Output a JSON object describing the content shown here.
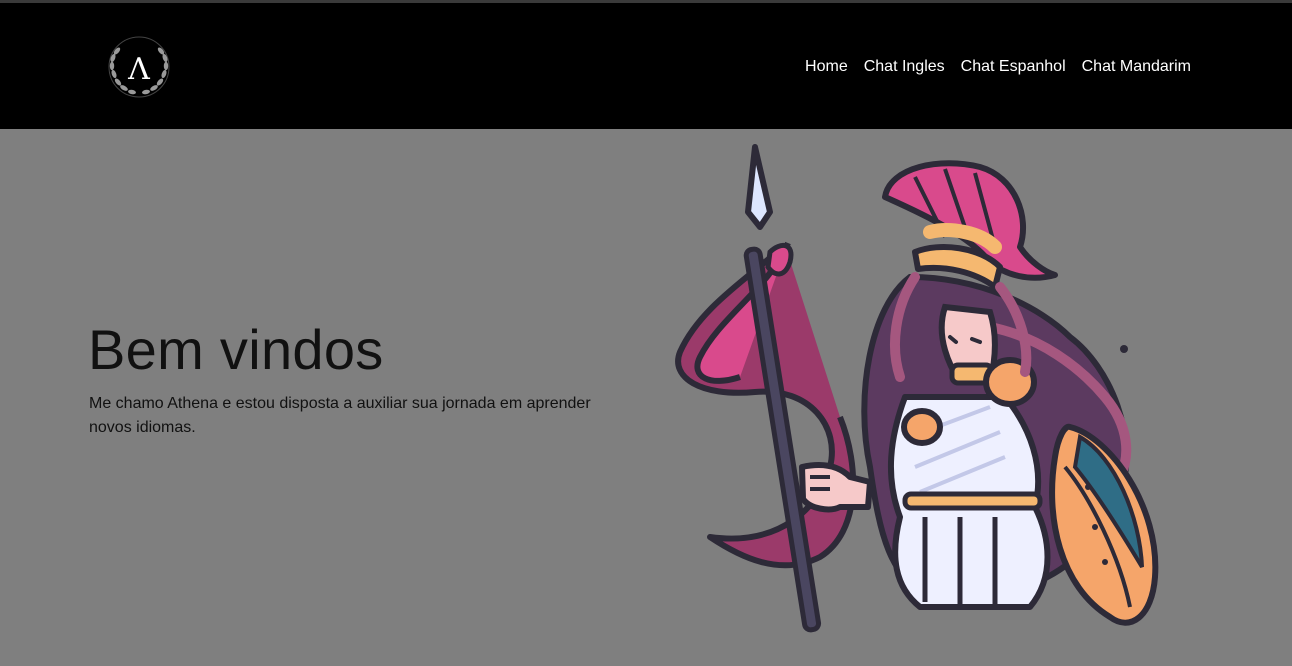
{
  "nav": {
    "items": [
      {
        "label": "Home"
      },
      {
        "label": "Chat Ingles"
      },
      {
        "label": "Chat Espanhol"
      },
      {
        "label": "Chat Mandarim"
      }
    ]
  },
  "logo": {
    "letter": "Λ",
    "icon": "laurel-wreath-icon"
  },
  "hero": {
    "title": "Bem vindos",
    "description": "Me chamo Athena e estou disposta a auxiliar sua jornada em aprender novos idiomas.",
    "illustration": "athena-warrior-illustration"
  },
  "colors": {
    "header_bg": "#000000",
    "page_bg": "#7f7f7f",
    "nav_text": "#ffffff",
    "hero_text": "#111111",
    "accent_pink": "#d94a8c",
    "accent_purple": "#5c3a60",
    "outline": "#2d2a38"
  }
}
